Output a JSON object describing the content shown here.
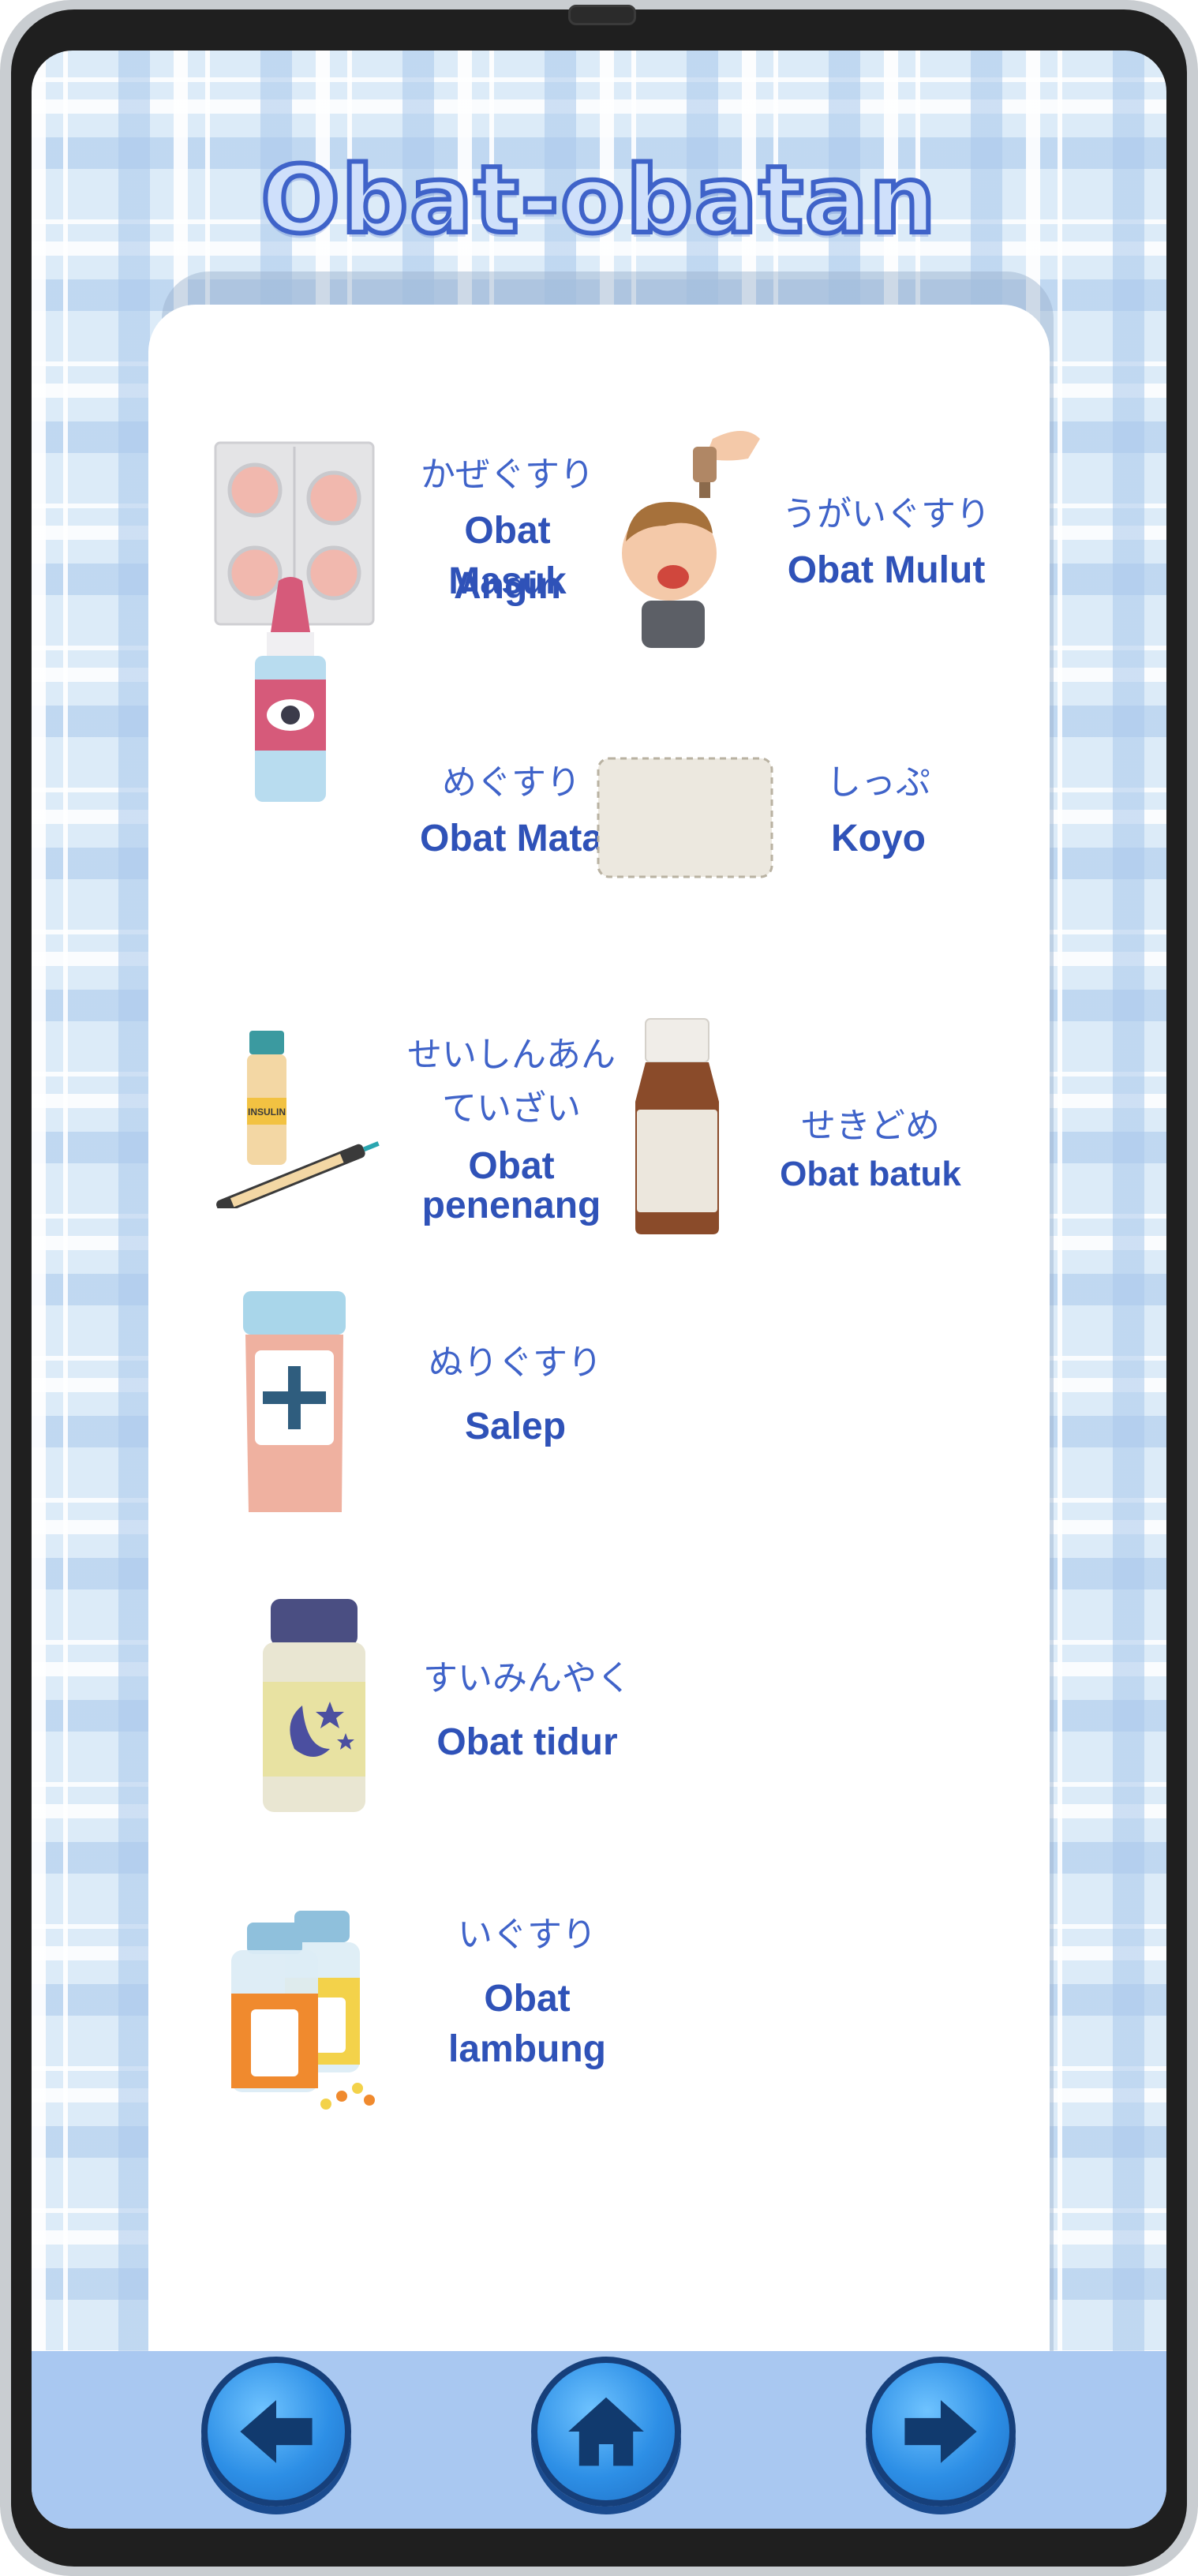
{
  "page": {
    "title": "Obat-obatan"
  },
  "items": [
    {
      "jp": "かぜぐすり",
      "id_line1": "Obat Masuk",
      "id_line2": "Angin",
      "icon": "tablet-blister-icon"
    },
    {
      "jp": "うがいぐすり",
      "id_line1": "Obat Mulut",
      "icon": "mouth-drops-icon"
    },
    {
      "jp": "めぐすり",
      "id_line1": "Obat Mata",
      "icon": "eye-drops-icon"
    },
    {
      "jp": "しっぷ",
      "id_line1": "Koyo",
      "icon": "patch-icon"
    },
    {
      "jp_line1": "せいしんあん",
      "jp_line2": "ていざい",
      "id_line1": "Obat",
      "id_line2": "penenang",
      "icon": "insulin-syringe-icon"
    },
    {
      "jp": "せきどめ",
      "id_line1": "Obat batuk",
      "icon": "cough-syrup-bottle-icon"
    },
    {
      "jp": "ぬりぐすり",
      "id_line1": "Salep",
      "icon": "ointment-jar-icon"
    },
    {
      "jp": "すいみんやく",
      "id_line1": "Obat tidur",
      "icon": "sleeping-pill-bottle-icon"
    },
    {
      "jp": "いぐすり",
      "id_line1": "Obat lambung",
      "icon": "pill-bottles-icon"
    }
  ],
  "navigation": {
    "back_icon": "arrow-left-icon",
    "home_icon": "home-icon",
    "next_icon": "arrow-right-icon"
  },
  "colors": {
    "accent": "#3f63c9",
    "nav_button": "#2d8fe6",
    "bottom_bar": "#a9c8f1"
  }
}
